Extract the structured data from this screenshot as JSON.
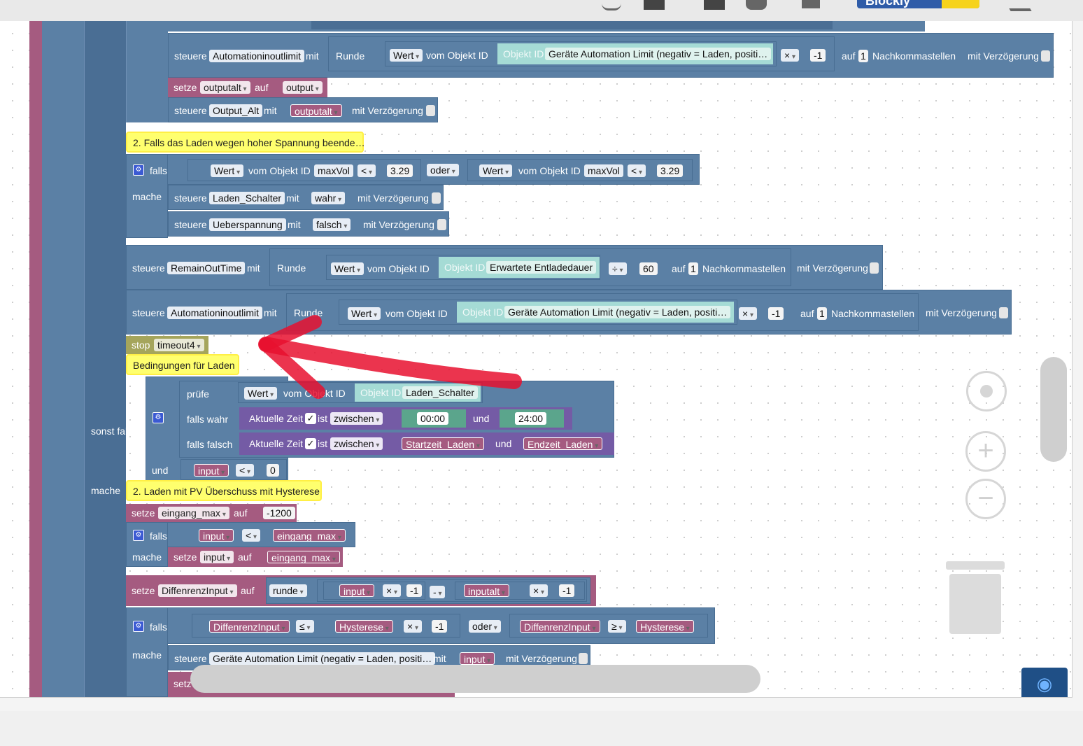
{
  "toolbar": {
    "logo_text": "Blockly"
  },
  "colors": {
    "accent_arrow": "#e8102f",
    "procedure_pink": "#a55b80",
    "logic_blue": "#5b80a5",
    "comment_yellow": "#ffff6e"
  },
  "blocks": {
    "row1": {
      "steuere": "steuere",
      "target": "Automationinoutlimit",
      "mit": "mit",
      "runde": "Runde",
      "wert": "Wert",
      "vom": "vom Objekt ID",
      "objid": "Objekt ID",
      "object": "Geräte Automation Limit (negativ = Laden, positi…",
      "op": "×",
      "num": "-1",
      "auf": "auf",
      "digits": "1",
      "nachkomma": "Nachkommastellen",
      "delay": "mit Verzögerung"
    },
    "row2": {
      "setze": "setze",
      "var": "outputalt",
      "auf": "auf",
      "value": "output"
    },
    "row3": {
      "steuere": "steuere",
      "target": "Output_Alt",
      "mit": "mit",
      "value": "outputalt",
      "delay": "mit Verzögerung"
    },
    "comment1": "2. Falls das Laden wegen hoher Spannung beende…",
    "if1": {
      "falls": "falls",
      "wert": "Wert",
      "vom": "vom Objekt ID",
      "obj": "maxVol",
      "op": "<",
      "num": "3.29",
      "oder": "oder",
      "mache": "mache"
    },
    "row_laden": {
      "steuere": "steuere",
      "target": "Laden_Schalter",
      "mit": "mit",
      "value": "wahr",
      "delay": "mit Verzögerung"
    },
    "row_ueber": {
      "steuere": "steuere",
      "target": "Ueberspannung",
      "mit": "mit",
      "value": "falsch",
      "delay": "mit Verzögerung"
    },
    "row_remain": {
      "steuere": "steuere",
      "target": "RemainOutTime",
      "mit": "mit",
      "runde": "Runde",
      "wert": "Wert",
      "vom": "vom Objekt ID",
      "objid": "Objekt ID",
      "object": "Erwartete Entladedauer",
      "op": "÷",
      "num": "60",
      "auf": "auf",
      "digits": "1",
      "nachkomma": "Nachkommastellen",
      "delay": "mit Verzögerung"
    },
    "row_auto2": {
      "steuere": "steuere",
      "target": "Automationinoutlimit",
      "mit": "mit",
      "runde": "Runde",
      "wert": "Wert",
      "vom": "vom Objekt ID",
      "objid": "Objekt ID",
      "object": "Geräte Automation Limit (negativ = Laden, positi…",
      "op": "×",
      "num": "-1",
      "auf": "auf",
      "digits": "1",
      "nachkomma": "Nachkommastellen",
      "delay": "mit Verzögerung"
    },
    "stop": {
      "label": "stop",
      "timer": "timeout4"
    },
    "comment2": "Bedingungen für Laden",
    "sonst_falls": "sonst falls",
    "pruefe": {
      "label": "prüfe",
      "wert": "Wert",
      "vom": "vom Objekt ID",
      "objid": "Objekt ID",
      "object": "Laden_Schalter"
    },
    "falls_wahr": {
      "label": "falls wahr",
      "zeit": "Aktuelle Zeit",
      "check": "✓",
      "ist": "ist",
      "zwischen": "zwischen",
      "from": "00:00",
      "und": "und",
      "to": "24:00"
    },
    "falls_falsch": {
      "label": "falls falsch",
      "zeit": "Aktuelle Zeit",
      "check": "✓",
      "ist": "ist",
      "zwischen": "zwischen",
      "from": "Startzeit_Laden",
      "und": "und",
      "to": "Endzeit_Laden"
    },
    "und_row": {
      "und": "und",
      "var": "input",
      "op": "<",
      "num": "0"
    },
    "mache2": "mache",
    "comment3": "2. Laden mit PV Überschuss mit Hysterese",
    "setze_max": {
      "setze": "setze",
      "var": "eingang_max",
      "auf": "auf",
      "num": "-1200"
    },
    "if2": {
      "falls": "falls",
      "a": "input",
      "op": "<",
      "b": "eingang_max",
      "mache": "mache",
      "setze": "setze",
      "var": "input",
      "auf": "auf",
      "value": "eingang_max"
    },
    "setze_diff": {
      "setze": "setze",
      "var": "DiffenrenzInput",
      "auf": "auf",
      "runde": "runde",
      "a": "input",
      "mul": "×",
      "n1": "-1",
      "minus": "-",
      "b": "inputalt",
      "n2": "-1"
    },
    "if3": {
      "falls": "falls",
      "a": "DiffenrenzInput",
      "le": "≤",
      "b": "Hysterese",
      "mul": "×",
      "n": "-1",
      "oder": "oder",
      "c": "DiffenrenzInput",
      "ge": "≥",
      "d": "Hysterese",
      "mache": "mache"
    },
    "row_last": {
      "steuere": "steuere",
      "target": "Geräte Automation Limit (negativ = Laden, positi…",
      "mit": "mit",
      "value": "input",
      "delay": "mit Verzögerung",
      "setz": "setz"
    }
  },
  "controls": {
    "center": "center-icon",
    "zoom_in": "+",
    "zoom_out": "−",
    "trash": "trash-icon",
    "eye": "eye-icon"
  }
}
